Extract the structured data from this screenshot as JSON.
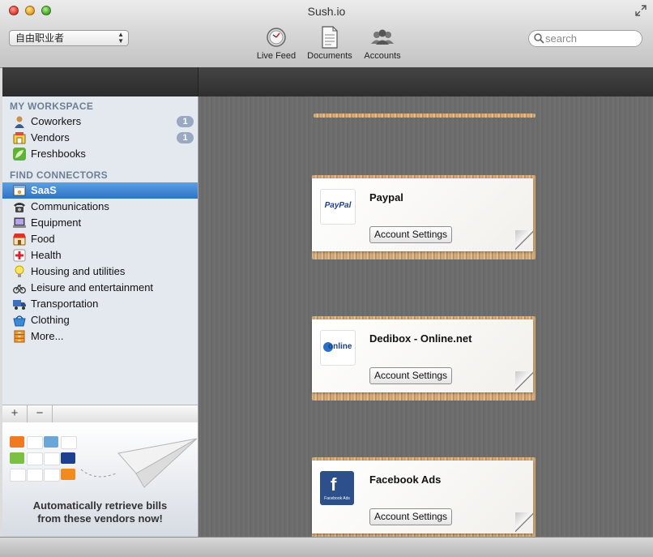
{
  "window": {
    "title": "Sush.io"
  },
  "toolbar": {
    "workspace_select": "自由职业者",
    "live_feed": "Live Feed",
    "documents": "Documents",
    "accounts": "Accounts",
    "search_placeholder": "search"
  },
  "sidebar": {
    "my_workspace": {
      "heading": "MY WORKSPACE",
      "items": [
        {
          "label": "Coworkers",
          "badge": "1",
          "icon": "person-icon"
        },
        {
          "label": "Vendors",
          "badge": "1",
          "icon": "vendor-icon"
        },
        {
          "label": "Freshbooks",
          "icon": "freshbooks-icon"
        }
      ]
    },
    "find_connectors": {
      "heading": "FIND CONNECTORS",
      "items": [
        {
          "label": "SaaS",
          "selected": true,
          "icon": "window-icon"
        },
        {
          "label": "Communications",
          "icon": "phone-icon"
        },
        {
          "label": "Equipment",
          "icon": "laptop-icon"
        },
        {
          "label": "Food",
          "icon": "store-icon"
        },
        {
          "label": "Health",
          "icon": "red-cross-icon"
        },
        {
          "label": "Housing and utilities",
          "icon": "lightbulb-icon"
        },
        {
          "label": "Leisure and entertainment",
          "icon": "bicycle-icon"
        },
        {
          "label": "Transportation",
          "icon": "truck-icon"
        },
        {
          "label": "Clothing",
          "icon": "basket-icon"
        },
        {
          "label": "More...",
          "icon": "drawers-icon"
        }
      ]
    },
    "add": "+",
    "remove": "−",
    "promo_line1": "Automatically retrieve bills",
    "promo_line2": "from these vendors now!"
  },
  "connectors": [
    {
      "name": "Paypal",
      "logo_text": "PayPal",
      "button": "Account Settings"
    },
    {
      "name": "Dedibox - Online.net",
      "logo_text": "online",
      "button": "Account Settings"
    },
    {
      "name": "Facebook Ads",
      "logo_text": "Facebook Ads",
      "button": "Account Settings"
    }
  ],
  "colors": {
    "selection": "#2e73c6",
    "section_heading": "#6d7f95",
    "badge": "#9aa9c2"
  }
}
